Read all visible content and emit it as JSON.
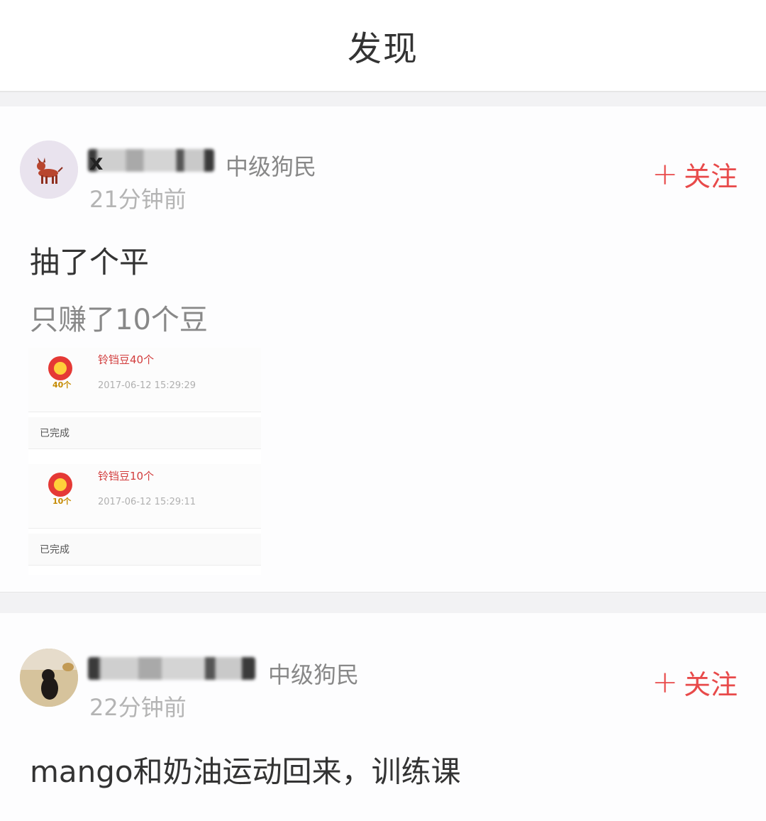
{
  "header": {
    "title": "发现"
  },
  "posts": [
    {
      "user_initial": "x",
      "level": "中级狗民",
      "time": "21分钟前",
      "follow_plus": "+",
      "follow_label": "关注",
      "title": "抽了个平",
      "subtitle": "只赚了10个豆",
      "embed": {
        "records": [
          {
            "title": "铃铛豆40个",
            "badge": "40个",
            "time": "2017-06-12 15:29:29",
            "status": "已完成"
          },
          {
            "title": "铃铛豆10个",
            "badge": "10个",
            "time": "2017-06-12 15:29:11",
            "status": "已完成"
          }
        ]
      }
    },
    {
      "user_initial": "",
      "level": "中级狗民",
      "time": "22分钟前",
      "follow_plus": "+",
      "follow_label": "关注",
      "title": "mango和奶油运动回来，训练课"
    }
  ],
  "colors": {
    "accent": "#e84a4a",
    "separator": "#f2f2f4"
  },
  "icons": [
    "dog-avatar-icon",
    "coin-icon"
  ]
}
